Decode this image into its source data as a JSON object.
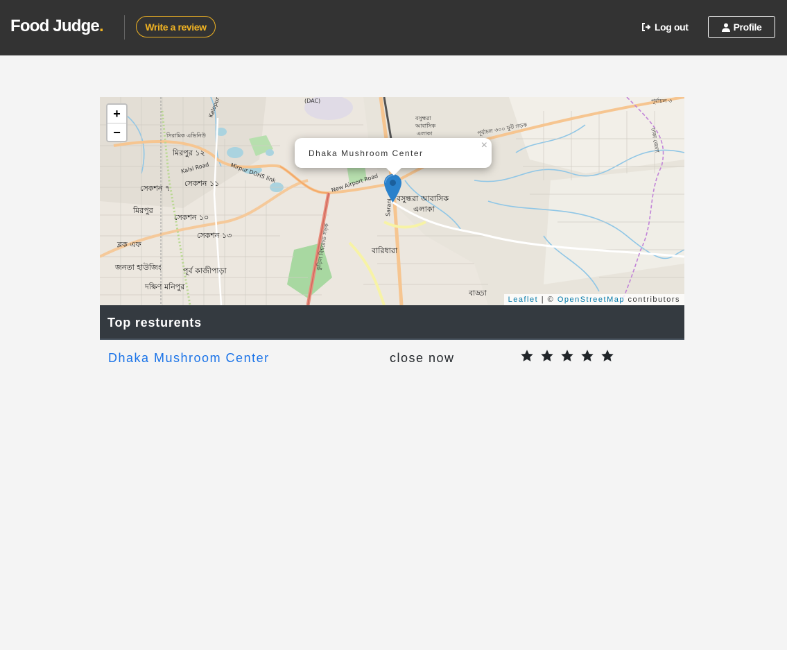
{
  "header": {
    "logo_text": "Food Judge",
    "logo_dot": ".",
    "write_review_label": "Write a review",
    "logout_label": "Log out",
    "profile_label": "Profile",
    "accent_color": "#f0b323",
    "icons": [
      "logout-icon",
      "user-icon"
    ]
  },
  "map": {
    "zoom_in": "+",
    "zoom_out": "−",
    "popup_text": "Dhaka Mushroom Center",
    "popup_close": "×",
    "attribution_leaflet": "Leaflet",
    "attribution_sep": " | © ",
    "attribution_osm": "OpenStreetMap",
    "attribution_suffix": " contributors",
    "labels": {
      "mirpur12": "মিরপুর ১২",
      "sec11": "সেকশন ১১",
      "sec7": "সেকশন ৭",
      "mirpur": "মিরপুর",
      "sec10": "সেকশন ১০",
      "sec13": "সেকশন ১৩",
      "blockf": "ব্লক এফ",
      "janata": "জনতা হাউজিং",
      "purbakazi": "পূর্ব কাজীপাড়া",
      "dakshin": "দক্ষিণ মনিপুর",
      "bashundhara": "বসুন্ধরা আবাসিক",
      "elaka": "এলাকা",
      "baridhara": "বারিধারা",
      "badda": "বাড্ডা",
      "kalsi": "Kalsi Road",
      "dohs": "Mirpur DOHS link",
      "airport": "New Airport Road",
      "dac": "(DAC)",
      "ceramic": "সিরামিক এভিনিউ",
      "bashu_top": "বসুন্ধরা",
      "abasik_top": "আবাসিক",
      "elaka_top": "এলাকা",
      "sarani": "Sarani",
      "kuril": "কুড়িল বিশ্বরোড সড়ক",
      "purbachal": "পূর্বাচল ৩০০ ফুট সড়ক",
      "kalopara": "Kalopur",
      "purbachal_top": "পূর্বাচল ৩",
      "dhaka_zila": "ঢাকা জেলা"
    }
  },
  "panel": {
    "title": "Top resturents"
  },
  "restaurants": [
    {
      "name": "Dhaka Mushroom Center",
      "status": "close now",
      "rating": 5
    }
  ]
}
